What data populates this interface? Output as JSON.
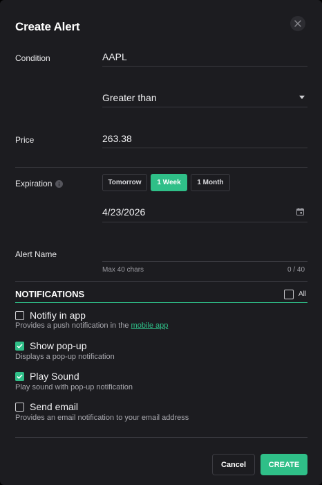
{
  "dialog": {
    "title": "Create Alert"
  },
  "condition": {
    "label": "Condition",
    "symbol": "AAPL",
    "operator": "Greater than"
  },
  "price": {
    "label": "Price",
    "value": "263.38"
  },
  "expiration": {
    "label": "Expiration",
    "options": [
      "Tomorrow",
      "1 Week",
      "1 Month"
    ],
    "selected": "1 Week",
    "date": "4/23/2026"
  },
  "alert_name": {
    "label": "Alert Name",
    "value": "",
    "hint": "Max 40 chars",
    "counter": "0 / 40"
  },
  "notifications": {
    "title": "NOTIFICATIONS",
    "all_label": "All",
    "all_checked": false,
    "items": [
      {
        "label": "Notifiy in app",
        "desc_prefix": "Provides a push notification in the ",
        "desc_link": "mobile app",
        "checked": false
      },
      {
        "label": "Show pop-up",
        "desc_prefix": "Displays a pop-up notification",
        "desc_link": "",
        "checked": true
      },
      {
        "label": "Play Sound",
        "desc_prefix": "Play sound with pop-up notification",
        "desc_link": "",
        "checked": true
      },
      {
        "label": "Send email",
        "desc_prefix": "Provides an email notification to your email address",
        "desc_link": "",
        "checked": false
      }
    ]
  },
  "actions": {
    "cancel_label": "Cancel",
    "create_label": "CREATE"
  },
  "colors": {
    "accent": "#2fbf88",
    "background": "#1c1c20"
  }
}
